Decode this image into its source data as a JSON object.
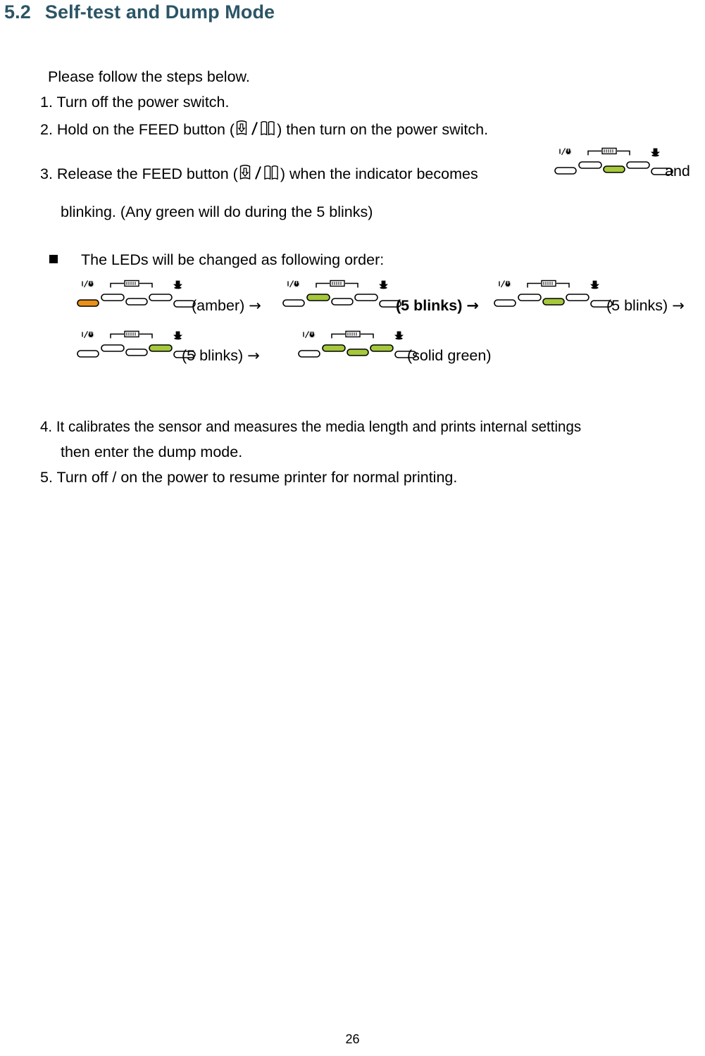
{
  "document": {
    "section_number": "5.2",
    "section_title": "Self-test and Dump Mode",
    "heading_color": "#2b5566",
    "page_number": "26"
  },
  "intro": {
    "line": "Please follow the steps below."
  },
  "steps": [
    {
      "id": "step-1",
      "text": "1. Turn off the power switch."
    },
    {
      "id": "step-2",
      "prefix": "2. Hold on the FEED button (",
      "icon": "feed-button-icon",
      "suffix": ") then turn on the power switch."
    },
    {
      "id": "step-3",
      "prefix": "3. Release the FEED button (",
      "icon": "feed-button-icon",
      "middle": ") when the indicator becomes",
      "suffix": "and",
      "continuation": "blinking. (Any green will do during the 5 blinks)"
    },
    {
      "id": "step-4",
      "text": "4. It calibrates the sensor and measures the media length and prints internal settings",
      "continuation": "then enter the dump mode."
    },
    {
      "id": "step-5",
      "text": "5. Turn off / on the power to resume printer for normal printing."
    }
  ],
  "led_note": {
    "bullet_text": "The LEDs will be changed as following order:"
  },
  "led_icons": {
    "power": "power-icon",
    "ribbon": "ribbon-icon",
    "error": "error-icon"
  },
  "led_colors": {
    "amber": "#E8921C",
    "green": "#A5C83C",
    "off": "#FFFFFF",
    "outline": "#000000"
  },
  "led_sequence": [
    {
      "id": "led-state-amber",
      "states": [
        "amber",
        "off",
        "off",
        "off",
        "off"
      ],
      "label": "(amber)",
      "label_bold": false,
      "arrow": "→"
    },
    {
      "id": "led-state-green-1",
      "states": [
        "off",
        "green",
        "off",
        "off",
        "off"
      ],
      "label": "(5 blinks)",
      "label_bold": true,
      "arrow": "→"
    },
    {
      "id": "led-state-green-2",
      "states": [
        "off",
        "off",
        "green",
        "off",
        "off"
      ],
      "label": "(5 blinks)",
      "label_bold": false,
      "arrow": "→"
    },
    {
      "id": "led-state-green-3",
      "states": [
        "off",
        "off",
        "off",
        "green",
        "off"
      ],
      "label": "(5 blinks)",
      "label_bold": false,
      "arrow": "→"
    },
    {
      "id": "led-state-solid-green",
      "states": [
        "off",
        "green",
        "green",
        "green",
        "off"
      ],
      "label": "(solid green)",
      "label_bold": false,
      "arrow": ""
    }
  ],
  "indicator_inline": {
    "id": "indicator-step3",
    "states": [
      "off",
      "off",
      "green",
      "off",
      "off"
    ]
  }
}
